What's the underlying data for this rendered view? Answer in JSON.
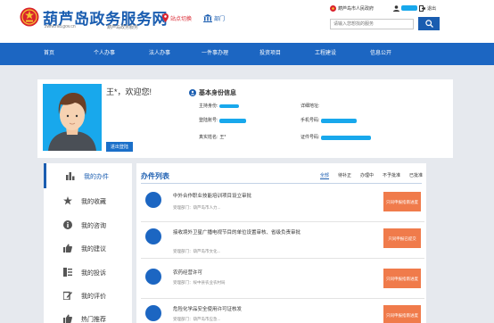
{
  "header": {
    "site_title": "葫芦岛政务服务网",
    "site_domain": "zwfw.hld.gov.cn",
    "site_slogan": "葫芦岛政务服务",
    "location_label": "站点切换",
    "department_label": "部门",
    "gov_link": "葫芦岛市人民政府",
    "logout_label": "退出",
    "search_placeholder": "请输入您想找的服务"
  },
  "nav": {
    "items": [
      {
        "label": "首页"
      },
      {
        "label": "个人办事"
      },
      {
        "label": "法人办事"
      },
      {
        "label": "一件事办理"
      },
      {
        "label": "投资项目"
      },
      {
        "label": "工程建设"
      },
      {
        "label": "信息公开"
      }
    ]
  },
  "profile": {
    "welcome": "王*，欢迎您!",
    "cert_button": "进出登陆",
    "section_title": "基本身份信息",
    "fields": {
      "subject_type": "主持身份:",
      "detail_address": "详细地址:",
      "login_account": "登陆账号:",
      "phone": "手机号码:",
      "real_name": "真实姓名:",
      "real_name_value": "王*",
      "id_number": "证件号码:"
    }
  },
  "sidebar": {
    "items": [
      {
        "label": "我的办件",
        "icon": "bar-chart-icon",
        "active": true
      },
      {
        "label": "我的收藏",
        "icon": "star-icon",
        "active": false
      },
      {
        "label": "我的咨询",
        "icon": "info-icon",
        "active": false
      },
      {
        "label": "我的建议",
        "icon": "thumbs-up-icon",
        "active": false
      },
      {
        "label": "我的投诉",
        "icon": "document-icon",
        "active": false
      },
      {
        "label": "我的评价",
        "icon": "edit-icon",
        "active": false
      },
      {
        "label": "热门推荐",
        "icon": "thumbs-up-icon",
        "active": false
      }
    ]
  },
  "tasks": {
    "title": "办件列表",
    "tabs": [
      {
        "label": "全部",
        "active": true
      },
      {
        "label": "待补正",
        "active": false
      },
      {
        "label": "办理中",
        "active": false
      },
      {
        "label": "不予批准",
        "active": false
      },
      {
        "label": "已批准",
        "active": false
      }
    ],
    "items": [
      {
        "title": "中外合作职业技能培训项目设立审批",
        "dept": "受理部门：葫芦岛市人力...",
        "button": "只同申报指南进度"
      },
      {
        "title": "接收境外卫星广播电视节目的单位设置审核、省级负责审批",
        "dept": "受理部门：葫芦岛市文化...",
        "button": "只同申报已提交"
      },
      {
        "title": "农药经营许可",
        "dept": "受理部门：绥中县农业农村局",
        "button": "只同申报指南进度"
      },
      {
        "title": "危险化学品安全使用许可证核发",
        "dept": "受理部门：葫芦岛市应急...",
        "button": "只同申报指南进度"
      }
    ]
  },
  "colors": {
    "brand_blue": "#1c66c2",
    "redact_blue": "#18a8ec",
    "action_orange": "#f07b4b",
    "alert_red": "#d9232d"
  }
}
